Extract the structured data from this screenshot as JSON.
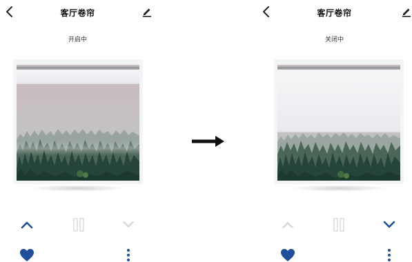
{
  "left": {
    "title": "客厅卷帘",
    "status": "开启中"
  },
  "right": {
    "title": "客厅卷帘",
    "status": "关闭中"
  },
  "colors": {
    "accent": "#1f4e9c",
    "disabled": "#cfd3d8",
    "text": "#222222"
  },
  "icons": [
    "back-arrow-icon",
    "edit-pencil-icon",
    "chevron-up-icon",
    "pause-icon",
    "chevron-down-icon",
    "heart-icon",
    "more-vertical-icon",
    "transition-arrow-icon"
  ]
}
